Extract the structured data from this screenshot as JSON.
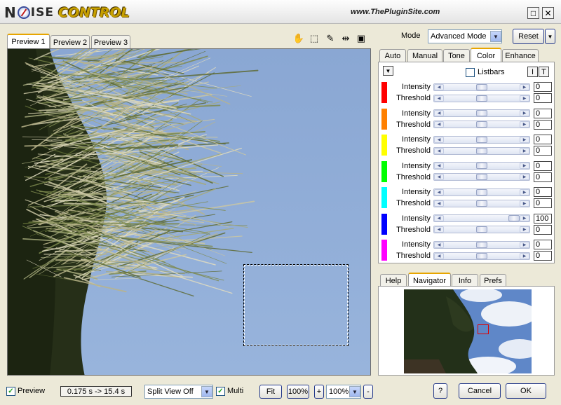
{
  "app": {
    "logo_n": "N",
    "logo_ise": "ISE",
    "logo_control": "CONTROL",
    "site": "www.ThePluginSite.com"
  },
  "window": {
    "maximize_glyph": "□",
    "close_glyph": "✕"
  },
  "preview_tabs": [
    "Preview 1",
    "Preview 2",
    "Preview 3"
  ],
  "tools": [
    {
      "name": "hand-icon",
      "glyph": "✋"
    },
    {
      "name": "marquee-select-icon",
      "glyph": "⬚"
    },
    {
      "name": "eyedropper-icon",
      "glyph": "✎"
    },
    {
      "name": "split-compare-icon",
      "glyph": "⇹"
    },
    {
      "name": "fit-frame-icon",
      "glyph": "▣"
    }
  ],
  "mode": {
    "label": "Mode",
    "value": "Advanced Mode"
  },
  "reset_label": "Reset",
  "color_tabs": [
    "Auto",
    "Manual",
    "Tone",
    "Color",
    "Enhance"
  ],
  "listbars_label": "Listbars",
  "small_buttons": [
    "I",
    "T"
  ],
  "channels": [
    {
      "color": "#ff0000",
      "intensity_label": "Intensity",
      "threshold_label": "Threshold",
      "intensity": "0",
      "threshold": "0",
      "ipos": 0.5,
      "tpos": 0.5
    },
    {
      "color": "#ff8000",
      "intensity_label": "Intensity",
      "threshold_label": "Threshold",
      "intensity": "0",
      "threshold": "0",
      "ipos": 0.5,
      "tpos": 0.5
    },
    {
      "color": "#ffff00",
      "intensity_label": "Intensity",
      "threshold_label": "Threshold",
      "intensity": "0",
      "threshold": "0",
      "ipos": 0.5,
      "tpos": 0.5
    },
    {
      "color": "#00ff00",
      "intensity_label": "Intensity",
      "threshold_label": "Threshold",
      "intensity": "0",
      "threshold": "0",
      "ipos": 0.5,
      "tpos": 0.5
    },
    {
      "color": "#00ffff",
      "intensity_label": "Intensity",
      "threshold_label": "Threshold",
      "intensity": "0",
      "threshold": "0",
      "ipos": 0.5,
      "tpos": 0.5
    },
    {
      "color": "#0000ff",
      "intensity_label": "Intensity",
      "threshold_label": "Threshold",
      "intensity": "100",
      "threshold": "0",
      "ipos": 1.0,
      "tpos": 0.5
    },
    {
      "color": "#ff00ff",
      "intensity_label": "Intensity",
      "threshold_label": "Threshold",
      "intensity": "0",
      "threshold": "0",
      "ipos": 0.5,
      "tpos": 0.5
    }
  ],
  "bottom_tabs": [
    "Help",
    "Navigator",
    "Info",
    "Prefs"
  ],
  "footer": {
    "preview_label": "Preview",
    "timing": "0.175 s -> 15.4 s",
    "split_view": "Split View Off",
    "multi_label": "Multi",
    "fit_label": "Fit",
    "zoom_100": "100%",
    "plus": "+",
    "zoom_value": "100%",
    "minus": "-",
    "help_label": "?",
    "cancel_label": "Cancel",
    "ok_label": "OK"
  }
}
